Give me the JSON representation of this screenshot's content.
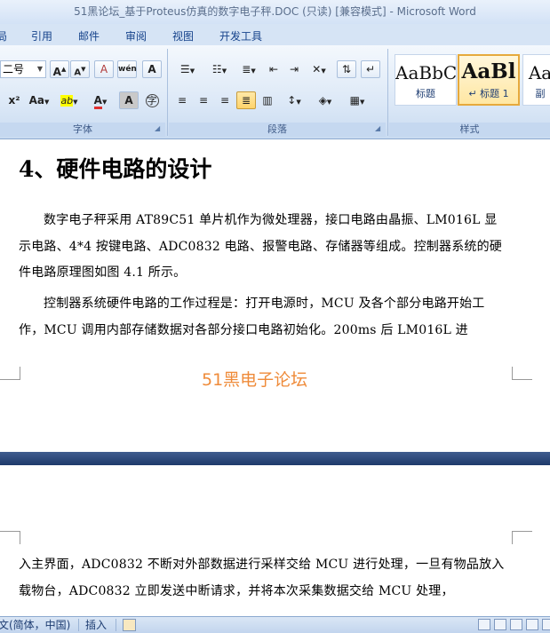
{
  "window": {
    "title": "51黑论坛_基于Proteus仿真的数字电子秤.DOC (只读) [兼容模式] - Microsoft Word"
  },
  "ribbon_tabs": [
    "局",
    "引用",
    "邮件",
    "审阅",
    "视图",
    "开发工具"
  ],
  "font_group": {
    "font_size": "二号",
    "label": "字体",
    "grow_label": "A",
    "shrink_label": "A",
    "clear_label": "A",
    "phonetic_label": "wén",
    "border_char_label": "A",
    "subscript_label": "x²",
    "case_label": "Aa",
    "highlight_label": "ab",
    "font_color_label": "A",
    "shade_label": "A",
    "enclose_label": "字"
  },
  "paragraph_group": {
    "label": "段落"
  },
  "styles_group": {
    "label": "样式",
    "styles": [
      {
        "sample": "AaBbC",
        "name": "标题"
      },
      {
        "sample": "AaBl",
        "name": "↵ 标题 1"
      },
      {
        "sample": "Aa",
        "name": "副"
      }
    ]
  },
  "document": {
    "heading": "4、硬件电路的设计",
    "paragraph1": "数字电子秤采用 AT89C51 单片机作为微处理器，接口电路由晶振、LM016L 显示电路、4*4 按键电路、ADC0832 电路、报警电路、存储器等组成。控制器系统的硬件电路原理图如图 4.1 所示。",
    "paragraph2": "控制器系统硬件电路的工作过程是：打开电源时，MCU 及各个部分电路开始工作，MCU 调用内部存储数据对各部分接口电路初始化。200ms 后 LM016L 进",
    "watermark": "51黑电子论坛",
    "paragraph3": "入主界面，ADC0832 不断对外部数据进行采样交给 MCU 进行处理，一旦有物品放入载物台，ADC0832 立即发送中断请求，并将本次采集数据交给 MCU 处理，"
  },
  "statusbar": {
    "language": "文(简体，中国)",
    "insert_mode": "插入"
  }
}
